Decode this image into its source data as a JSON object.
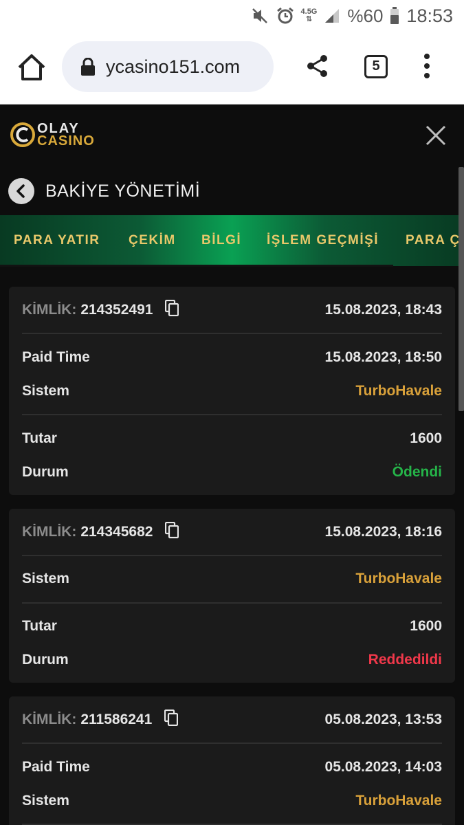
{
  "status_bar": {
    "battery": "%60",
    "time": "18:53",
    "network": "4.5G"
  },
  "browser": {
    "url": "ycasino151.com",
    "tab_count": "5"
  },
  "site": {
    "logo_top": "OLAY",
    "logo_bottom": "CASINO",
    "page_title": "BAKİYE YÖNETİMİ",
    "tabs": [
      "PARA YATIR",
      "ÇEKİM",
      "BİLGİ",
      "İŞLEM GEÇMİŞİ",
      "PARA ÇEKME"
    ]
  },
  "labels": {
    "id": "KİMLİK:",
    "paid_time": "Paid Time",
    "system": "Sistem",
    "amount": "Tutar",
    "status": "Durum"
  },
  "transactions": [
    {
      "id": "214352491",
      "created": "15.08.2023, 18:43",
      "paid_time": "15.08.2023, 18:50",
      "system": "TurboHavale",
      "amount": "1600",
      "status": "Ödendi"
    },
    {
      "id": "214345682",
      "created": "15.08.2023, 18:16",
      "system": "TurboHavale",
      "amount": "1600",
      "status": "Reddedildi"
    },
    {
      "id": "211586241",
      "created": "05.08.2023, 13:53",
      "paid_time": "05.08.2023, 14:03",
      "system": "TurboHavale"
    }
  ],
  "colors": {
    "accent_gold": "#d9a13a",
    "status_paid": "#25b449",
    "status_rejected": "#f0384a",
    "tab_green": "#0aa053"
  }
}
